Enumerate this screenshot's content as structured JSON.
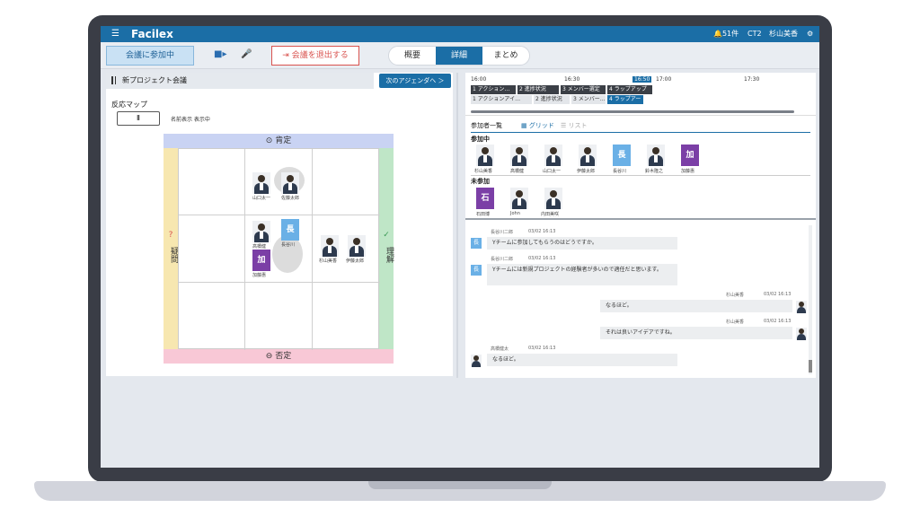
{
  "app": {
    "logo": "Facilex"
  },
  "topbar": {
    "notifications": "51件",
    "ct": "CT2",
    "user": "杉山美香"
  },
  "toolbar": {
    "join_label": "会議に参加中",
    "leave_label": "会議を退出する",
    "tabs": [
      {
        "label": "概要"
      },
      {
        "label": "詳細"
      },
      {
        "label": "まとめ"
      }
    ]
  },
  "meeting": {
    "title": "新プロジェクト会議",
    "next_agenda": "次のアジェンダへ ＞"
  },
  "reaction_map": {
    "label": "反応マップ",
    "pause": "Ⅱ",
    "toggle": "名前表示 表示中",
    "top": "⊙ 肯定",
    "bottom": "⊖ 否定",
    "left": "疑問",
    "right": "理解",
    "people": [
      {
        "name": "山口太一"
      },
      {
        "name": "佐藤太郎"
      },
      {
        "name": "高橋健"
      },
      {
        "name": "長谷川"
      },
      {
        "name": "加藤惠"
      },
      {
        "name": "杉山美香"
      },
      {
        "name": "伊藤太郎"
      }
    ],
    "badge_labels": [
      "長",
      "加"
    ]
  },
  "timeline": {
    "times": [
      "16:00",
      "16:30",
      "16:50",
      "17:00",
      "17:30"
    ],
    "row1": [
      "1 アクション…",
      "2 進捗状況",
      "3 メンバー選定",
      "4 ラップアップ"
    ],
    "row2": [
      "1 アクションアイ…",
      "2 進捗状況",
      "3 メンバー…",
      "4 ラップアー"
    ]
  },
  "participants": {
    "header": "参加者一覧",
    "grid_label": "グリッド",
    "list_label": "リスト",
    "active_label": "参加中",
    "inactive_label": "未参加",
    "active": [
      {
        "name": "杉山美香"
      },
      {
        "name": "高橋健"
      },
      {
        "name": "山口太一"
      },
      {
        "name": "伊藤太郎"
      },
      {
        "name": "長谷川",
        "badge": "長"
      },
      {
        "name": "鈴木隆之"
      },
      {
        "name": "加藤惠",
        "badge": "加"
      }
    ],
    "inactive": [
      {
        "name": "石田博",
        "badge": "石"
      },
      {
        "name": "John"
      },
      {
        "name": "内田美咲"
      }
    ]
  },
  "chat": {
    "messages": [
      {
        "author": "長谷川二郎",
        "date": "03/02 16:13",
        "text": "Yチームに参加してもらうのはどうですか。"
      },
      {
        "author": "長谷川二郎",
        "date": "03/02 16:13",
        "text": "Yチームには新規プロジェクトの経験者が多いので適任だと思います。"
      },
      {
        "author": "杉山美香",
        "date": "03/02 16:13",
        "text": "なるほど。"
      },
      {
        "author": "杉山美香",
        "date": "03/02 16:13",
        "text": "それは良いアイデアですね。"
      },
      {
        "author": "高橋健太",
        "date": "03/02 16:13",
        "text": "なるほど。"
      }
    ]
  },
  "colors": {
    "brand": "#1b6ea6",
    "badge_blue": "#6ab0e6",
    "badge_purple": "#7b3fa6",
    "leave_red": "#d9534f"
  }
}
